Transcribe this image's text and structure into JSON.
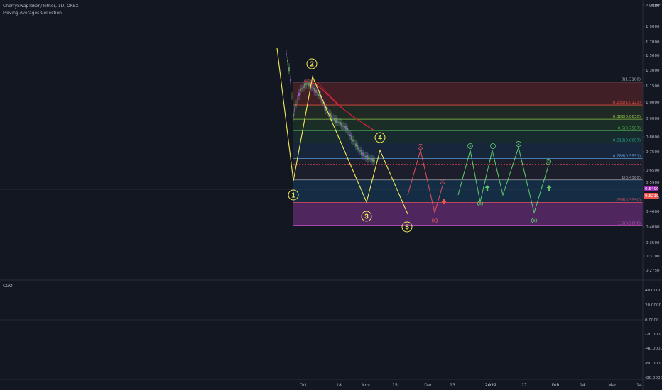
{
  "header": {
    "symbol": "CherrySwapToken/Tether, 1D, OKEX",
    "indicator": "Moving Averages Collection",
    "currency": "USDT",
    "oscillator": "CGO"
  },
  "colors": {
    "background": "#131722",
    "candle": "#b45af0",
    "wave": "#f2e95a",
    "bearish_projection": "#e05060",
    "bullish_projection": "#5ccd6a",
    "price_badge_purple": "#9c27b0",
    "price_badge_red": "#ef5350"
  },
  "chart_data": {
    "type": "candlestick",
    "title": "CherrySwapToken/Tether, 1D, OKEX",
    "y_scale": "log",
    "price_axis_ticks": [
      "2.2000",
      "1.9000",
      "1.7000",
      "1.5000",
      "1.3000",
      "1.1500",
      "1.0000",
      "0.9000",
      "0.8000",
      "0.7500",
      "0.6500",
      "0.5900",
      "0.5200",
      "0.4600",
      "0.4000",
      "0.3500",
      "0.3100",
      "0.2750"
    ],
    "time_axis_ticks": [
      "Oct",
      "18",
      "Nov",
      "15",
      "Dec",
      "13",
      "2022",
      "17",
      "Feb",
      "14",
      "Mar",
      "14"
    ],
    "current_prices": [
      "0.5490",
      "0.5210"
    ],
    "fib_levels": [
      {
        "label": "0(1.3100)",
        "value": 1.31,
        "color": "#b2b5be"
      },
      {
        "label": "0.236(1.0123)",
        "value": 1.0123,
        "color": "#e0503c"
      },
      {
        "label": "0.382(0.8630)",
        "value": 0.863,
        "color": "#8bc34a"
      },
      {
        "label": "0.5(0.7587)",
        "value": 0.7587,
        "color": "#4caf50"
      },
      {
        "label": "0.618(0.6607)",
        "value": 0.6607,
        "color": "#26a69a"
      },
      {
        "label": "0.786(0.5551)",
        "value": 0.5551,
        "color": "#5b9bd5"
      },
      {
        "label": "1(0.4360)",
        "value": 0.436,
        "color": "#9aa0a6"
      },
      {
        "label": "1.236(0.3390)",
        "value": 0.339,
        "color": "#e05060"
      },
      {
        "label": "1.5(0.2600)",
        "value": 0.26,
        "color": "#c050c0"
      }
    ],
    "elliott_wave_labels": [
      "1",
      "2",
      "3",
      "4",
      "5"
    ],
    "projection_labels": [
      "A",
      "B",
      "C"
    ],
    "oscillator": {
      "name": "CGO",
      "ticks": [
        "40.0000",
        "20.0000",
        "0.0000",
        "-20.0000",
        "-40.0000",
        "-60.0000",
        "-80.0000"
      ]
    }
  }
}
